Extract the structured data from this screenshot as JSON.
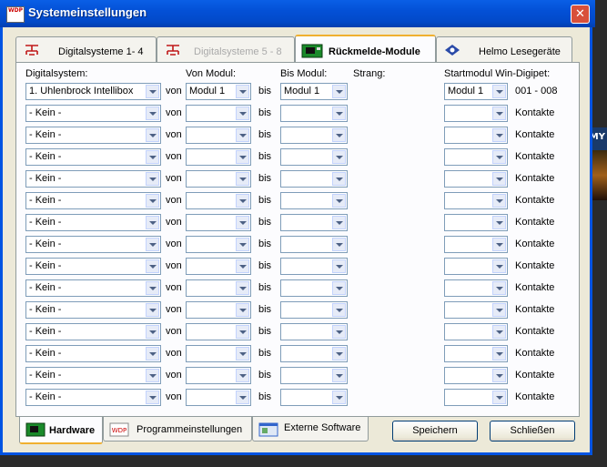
{
  "window": {
    "title": "Systemeinstellungen",
    "close_glyph": "✕",
    "app_icon_text": "WDP"
  },
  "desktop": {
    "side_text": "MY"
  },
  "top_tabs": [
    {
      "label": "Digitalsysteme 1- 4",
      "icon": "digital-system-icon"
    },
    {
      "label": "Digitalsysteme 5 - 8",
      "icon": "digital-system-icon"
    },
    {
      "label": "Rückmelde-Module",
      "icon": "feedback-module-icon"
    },
    {
      "label": "Helmo Lesegeräte",
      "icon": "helmo-reader-icon"
    }
  ],
  "headers": {
    "digitalsystem": "Digitalsystem:",
    "von_modul": "Von Modul:",
    "bis_modul": "Bis Modul:",
    "strang": "Strang:",
    "startmodul": "Startmodul Win-Digipet:"
  },
  "row_labels": {
    "von": "von",
    "bis": "bis"
  },
  "rows": [
    {
      "system": "1. Uhlenbrock Intellibox",
      "von": "Modul 1",
      "bis": "Modul 1",
      "start": "Modul 1",
      "info": "001 - 008"
    },
    {
      "system": " - Kein -",
      "von": "",
      "bis": "",
      "start": "",
      "info": "Kontakte"
    },
    {
      "system": " - Kein -",
      "von": "",
      "bis": "",
      "start": "",
      "info": "Kontakte"
    },
    {
      "system": " - Kein -",
      "von": "",
      "bis": "",
      "start": "",
      "info": "Kontakte"
    },
    {
      "system": " - Kein -",
      "von": "",
      "bis": "",
      "start": "",
      "info": "Kontakte"
    },
    {
      "system": " - Kein -",
      "von": "",
      "bis": "",
      "start": "",
      "info": "Kontakte"
    },
    {
      "system": " - Kein -",
      "von": "",
      "bis": "",
      "start": "",
      "info": "Kontakte"
    },
    {
      "system": " - Kein -",
      "von": "",
      "bis": "",
      "start": "",
      "info": "Kontakte"
    },
    {
      "system": " - Kein -",
      "von": "",
      "bis": "",
      "start": "",
      "info": "Kontakte"
    },
    {
      "system": " - Kein -",
      "von": "",
      "bis": "",
      "start": "",
      "info": "Kontakte"
    },
    {
      "system": " - Kein -",
      "von": "",
      "bis": "",
      "start": "",
      "info": "Kontakte"
    },
    {
      "system": " - Kein -",
      "von": "",
      "bis": "",
      "start": "",
      "info": "Kontakte"
    },
    {
      "system": " - Kein -",
      "von": "",
      "bis": "",
      "start": "",
      "info": "Kontakte"
    },
    {
      "system": " - Kein -",
      "von": "",
      "bis": "",
      "start": "",
      "info": "Kontakte"
    },
    {
      "system": " - Kein -",
      "von": "",
      "bis": "",
      "start": "",
      "info": "Kontakte"
    }
  ],
  "bottom_tabs": [
    {
      "label": "Hardware",
      "icon": "hardware-icon"
    },
    {
      "label": "Programmeinstellungen",
      "icon": "program-settings-icon"
    },
    {
      "label": "Externe Software",
      "icon": "external-software-icon"
    }
  ],
  "buttons": {
    "save": "Speichern",
    "close": "Schließen"
  }
}
